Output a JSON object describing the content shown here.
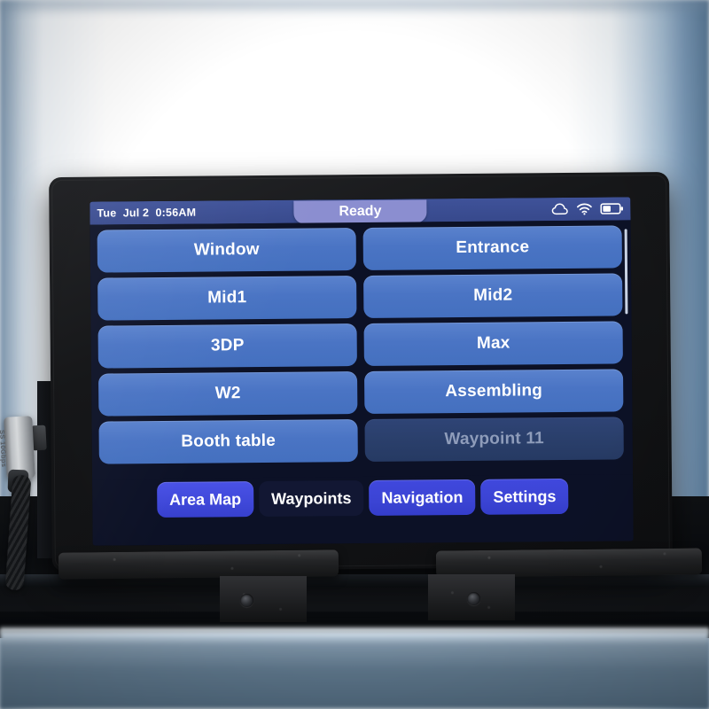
{
  "device": {
    "type": "tablet-control-panel",
    "bezel_color": "#16171a"
  },
  "status_bar": {
    "clock": "Tue  Jul 2  0:56AM",
    "state_pill": "Ready",
    "pill_color": "#8b8ed0",
    "bar_color": "#3c4e94",
    "icons": [
      {
        "name": "cloud-icon",
        "label": "Cloud"
      },
      {
        "name": "wifi-icon",
        "label": "Wi-Fi"
      },
      {
        "name": "battery-icon",
        "label": "Battery",
        "level_percent": 50
      }
    ]
  },
  "waypoints": {
    "rows": [
      [
        {
          "label": "Window",
          "enabled": true
        },
        {
          "label": "Entrance",
          "enabled": true
        }
      ],
      [
        {
          "label": "Mid1",
          "enabled": true
        },
        {
          "label": "Mid2",
          "enabled": true
        }
      ],
      [
        {
          "label": "3DP",
          "enabled": true
        },
        {
          "label": "Max",
          "enabled": true
        }
      ],
      [
        {
          "label": "W2",
          "enabled": true
        },
        {
          "label": "Assembling",
          "enabled": true
        }
      ],
      [
        {
          "label": "Booth table",
          "enabled": true
        },
        {
          "label": "Waypoint 11",
          "enabled": false
        }
      ]
    ],
    "button_color": "#4a74c4",
    "button_color_disabled": "#2a3f6b",
    "scrollbar_visible": true
  },
  "tab_bar": {
    "tabs": [
      {
        "label": "Area Map",
        "style": "accent",
        "active": false
      },
      {
        "label": "Waypoints",
        "style": "current",
        "active": true
      },
      {
        "label": "Navigation",
        "style": "normal",
        "active": false
      },
      {
        "label": "Settings",
        "style": "normal",
        "active": false
      }
    ],
    "accent_color": "#3b44d4"
  },
  "hardware": {
    "usb_adapter_label": "SS 10Gbps",
    "mount_brackets": 2,
    "screws": 2
  }
}
